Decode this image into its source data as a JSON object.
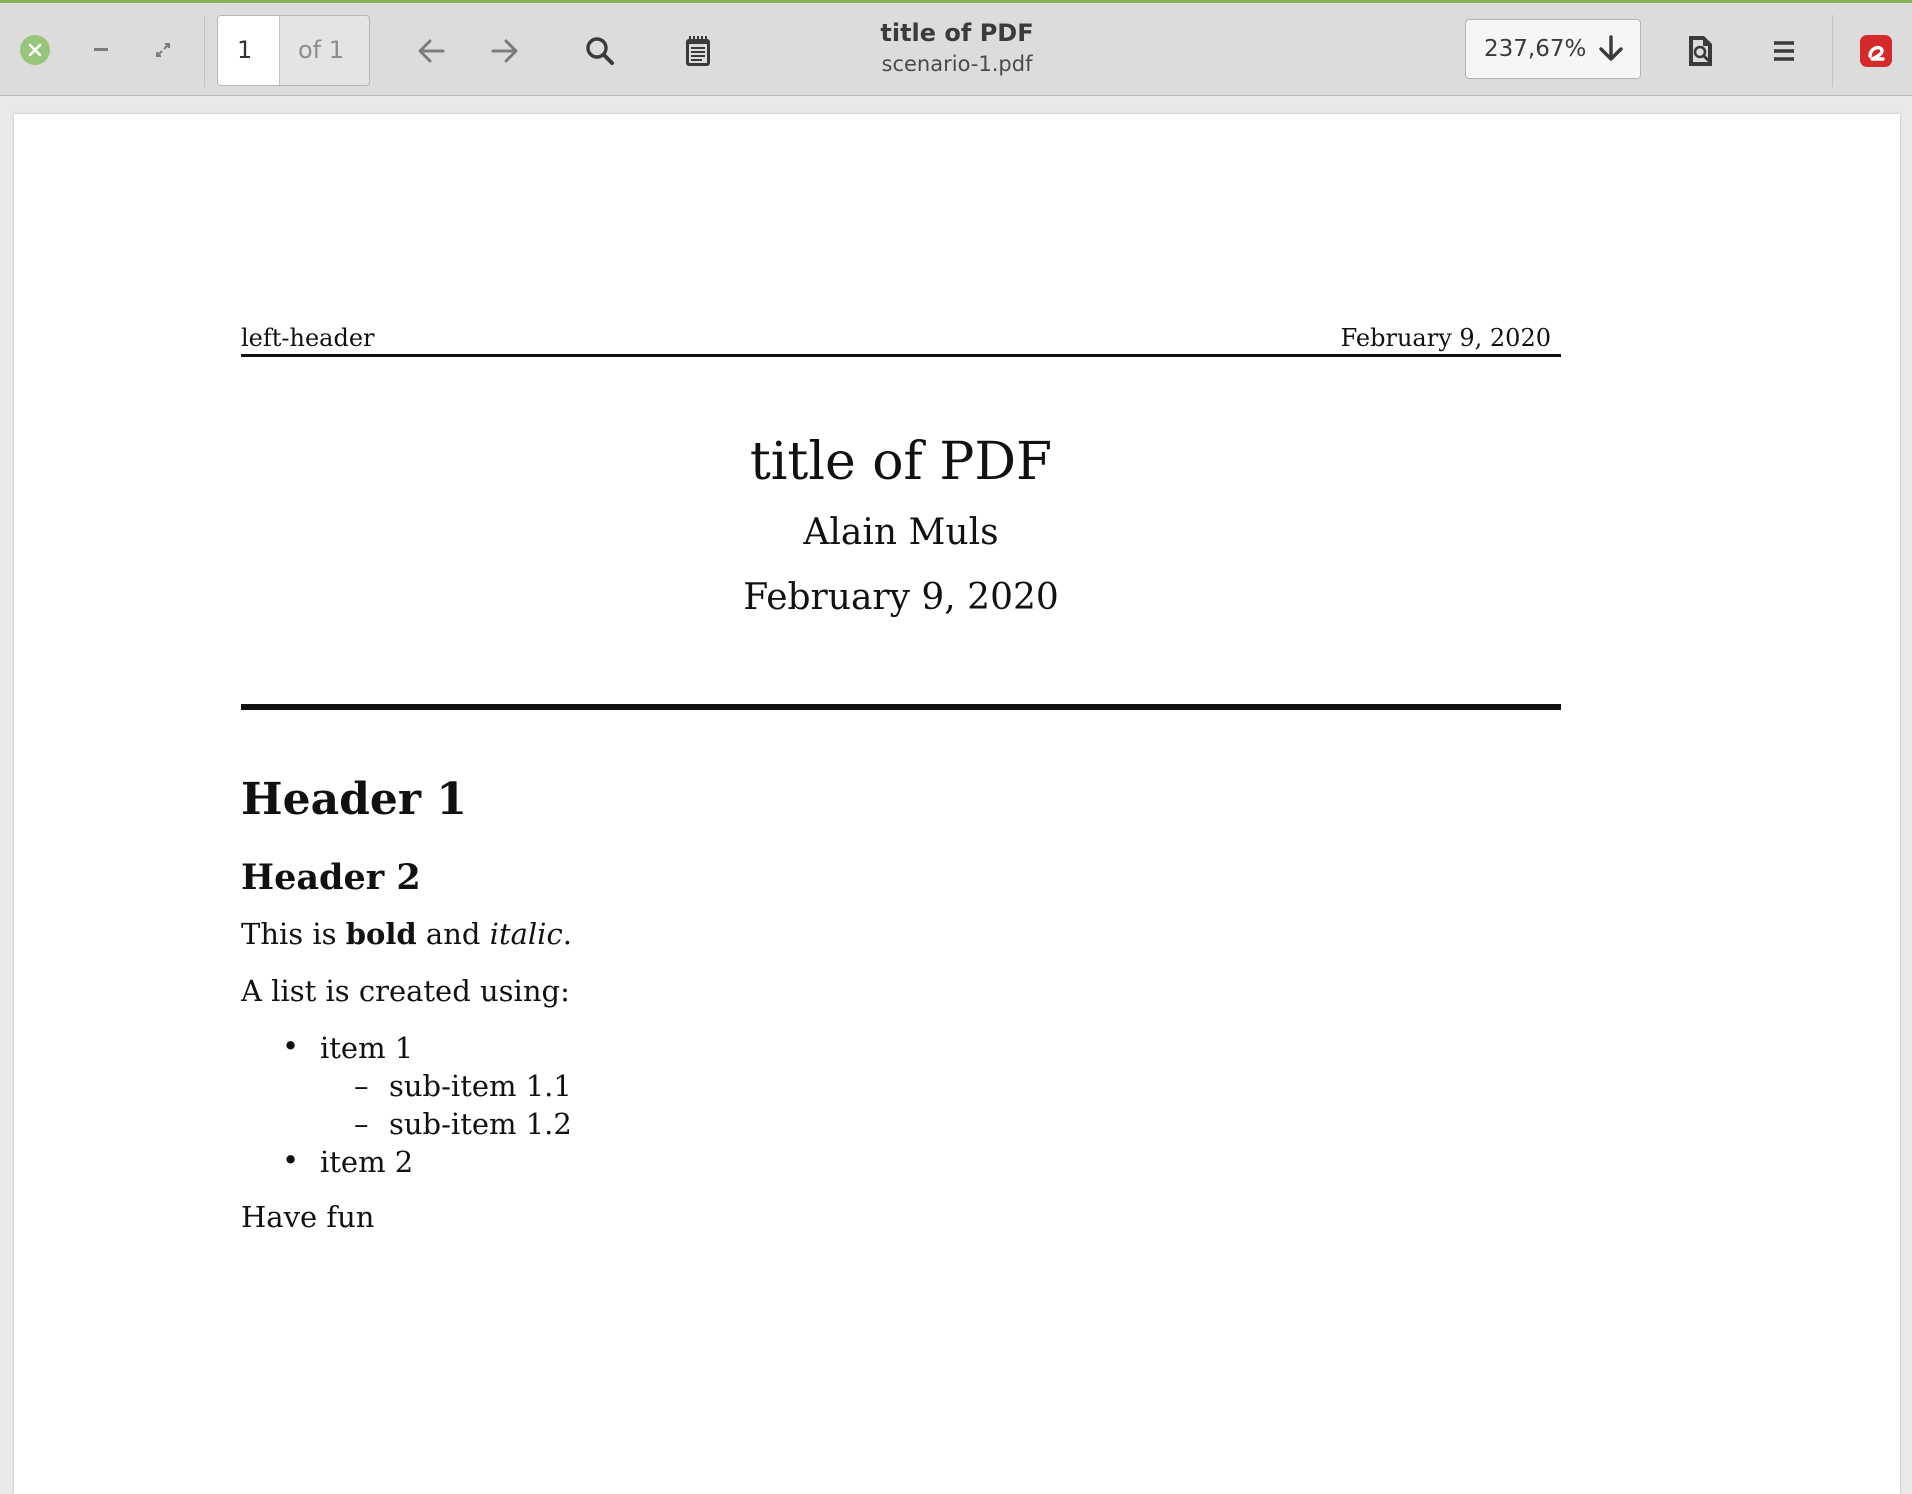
{
  "window": {
    "title": "title of PDF",
    "filename": "scenario-1.pdf"
  },
  "toolbar": {
    "page_current": "1",
    "page_total_label": "of 1",
    "zoom_level": "237,67%"
  },
  "document": {
    "header_left": "left-header",
    "header_right": "February 9, 2020",
    "title": "title of PDF",
    "author": "Alain Muls",
    "date": "February 9, 2020",
    "heading1": "Header 1",
    "heading2": "Header 2",
    "para1_start": "This is ",
    "para1_bold": "bold",
    "para1_mid": " and ",
    "para1_italic": "italic",
    "para1_end": ".",
    "para2": "A list is created using:",
    "list": {
      "item1": "item 1",
      "sub1": "sub-item 1.1",
      "sub2": "sub-item 1.2",
      "item2": "item 2",
      "bullet": "•",
      "dash": "–"
    },
    "closing": "Have fun"
  }
}
